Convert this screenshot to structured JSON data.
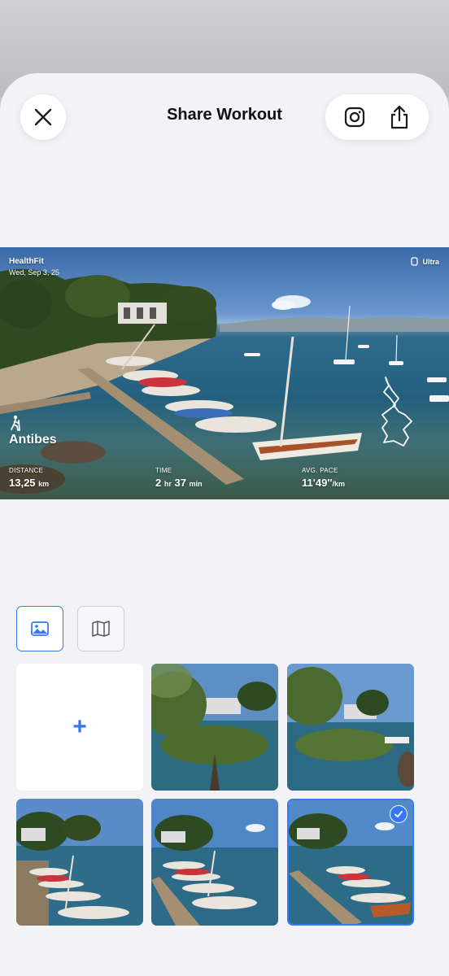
{
  "header": {
    "title": "Share Workout",
    "close_icon": "close-icon",
    "instagram_icon": "instagram-icon",
    "share_icon": "share-icon"
  },
  "preview": {
    "brand": "HealthFit",
    "date": "Wed, Sep 3, 25",
    "device": "Ultra",
    "activity_icon": "hiking-icon",
    "location": "Antibes",
    "metrics": [
      {
        "label": "DISTANCE",
        "value": "13,25",
        "unit": "km"
      },
      {
        "label": "TIME",
        "value": "2",
        "unit": "hr",
        "value2": "37",
        "unit2": "min"
      },
      {
        "label": "AVG. PACE",
        "value": "11'49''",
        "unit": "/km"
      }
    ]
  },
  "sources": [
    {
      "icon": "photo-icon",
      "selected": true
    },
    {
      "icon": "map-icon",
      "selected": false
    }
  ],
  "photos": {
    "add_label": "+",
    "selected_index": 5
  },
  "colors": {
    "accent": "#3478f6",
    "sheet_bg": "#f2f2f7"
  }
}
